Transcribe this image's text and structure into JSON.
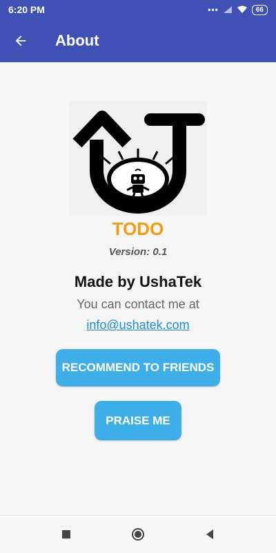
{
  "status_bar": {
    "time": "6:20 PM",
    "signal_dots": "•••",
    "battery_level": "66"
  },
  "app_bar": {
    "title": "About",
    "back_icon": "arrow-left-icon"
  },
  "about": {
    "app_name": "TODO",
    "version": "Version: 0.1",
    "made_by": "Made by UshaTek",
    "contact_text": "You can contact me at",
    "email": "info@ushatek.com"
  },
  "buttons": {
    "recommend_label": "RECOMMEND TO FRIENDS",
    "praise_label": "PRAISE ME"
  },
  "nav_bar": {
    "icons": [
      "recent-apps-icon",
      "home-icon",
      "back-icon"
    ]
  },
  "colors": {
    "primary": "#3f51b5",
    "accent": "#3eaee8",
    "app_name": "#f39c12",
    "link": "#1a8cd8"
  }
}
